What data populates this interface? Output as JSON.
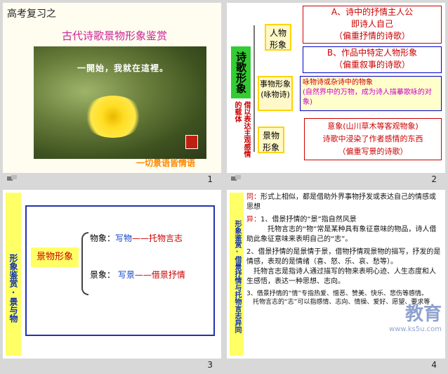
{
  "slides": [
    {
      "number": "1",
      "header": "高考复习之",
      "title": "古代诗歌景物形象鉴赏",
      "photo_caption": "一開始，我就在這裡。",
      "caption": "一切景语皆情语"
    },
    {
      "number": "2",
      "center": "诗歌形象",
      "side_note": "借以表达主观感情的载体",
      "person": "人物形象",
      "person_a": [
        "A、诗中的抒情主人公",
        "即诗人自己",
        "（偏重抒情的诗歌）"
      ],
      "person_b": [
        "B、作品中特定人物形象",
        "（偏重叙事的诗歌）"
      ],
      "object": "事物形象(咏物诗)",
      "object_desc": [
        "咏物诗或杂诗中的物象",
        "(自然界中的万物，成为诗人描摹歌咏的对象)"
      ],
      "scene": "景物形象",
      "scene_desc": [
        "意象(山川草木等客观物象)",
        "诗歌中浸染了作者感情的东西",
        "（偏重写景的诗歌）"
      ]
    },
    {
      "number": "3",
      "side": "形象鉴赏·景与物",
      "center": "景物形象",
      "wu_label": "物象：",
      "wu_value": "写物",
      "wu_result": "——托物言志",
      "jing_label": "景象：",
      "jing_value": "写景",
      "jing_result": "——借景抒情"
    },
    {
      "number": "4",
      "side": "形象鉴赏·借景抒情与托物言志异同",
      "p1_label": "同：",
      "p1": "形式上相似，都是借助外界事物抒发或表达自己的情感或思想",
      "p2_label": "异：",
      "p2a": "1、借景抒情的“景”指自然风景",
      "p2b": "托物言志的“物”常是某种具有象征意味的物品，诗人借助此象征意味来表明自己的“志”。",
      "p3": "2、借景抒情的是景情于景，借物抒情观景物的描写，抒发的是情感，表现的是情绪（喜、怒、乐、哀、愁等）。",
      "p3b": "托物言志是指诗人通过描写的物来表明心迹、人生态度和人生感悟，表达一种思想、志向。",
      "p4": "3、借景抒情的“情”专指热爱、憎恶、赞美、快乐、悲伤等感情。",
      "p4b": "托物言志的“志”可以指感情、志向、情操、爱好、愿望、要求等",
      "watermark": "教育",
      "watermark_url": "www.ks5u.com"
    }
  ]
}
